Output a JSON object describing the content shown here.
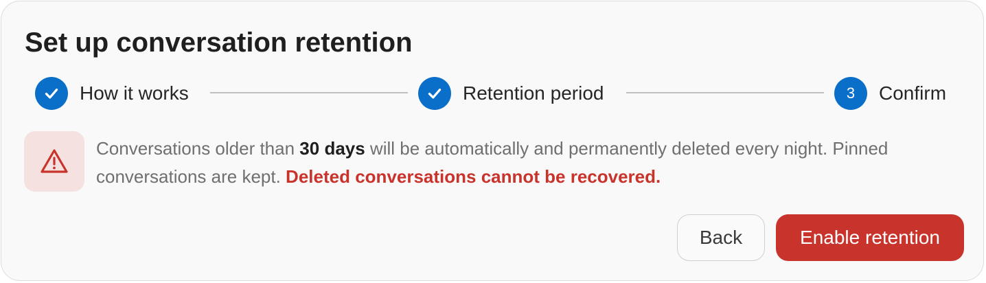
{
  "dialog": {
    "title": "Set up conversation retention"
  },
  "stepper": {
    "steps": [
      {
        "label": "How it works",
        "status": "completed",
        "icon": "check-icon"
      },
      {
        "label": "Retention period",
        "status": "completed",
        "icon": "check-icon"
      },
      {
        "label": "Confirm",
        "status": "current",
        "number": "3"
      }
    ]
  },
  "warning": {
    "icon": "warning-triangle-icon",
    "text_before": "Conversations older than ",
    "highlight": "30 days",
    "text_after": " will be automatically and permanently deleted every night. Pinned conversations are kept. ",
    "danger_text": "Deleted conversations cannot be recovered."
  },
  "actions": {
    "back_label": "Back",
    "enable_label": "Enable retention"
  },
  "colors": {
    "accent": "#0a6fc9",
    "danger": "#c8342b",
    "danger_bg": "#f4e1e0",
    "card_bg": "#f9f9f9"
  }
}
